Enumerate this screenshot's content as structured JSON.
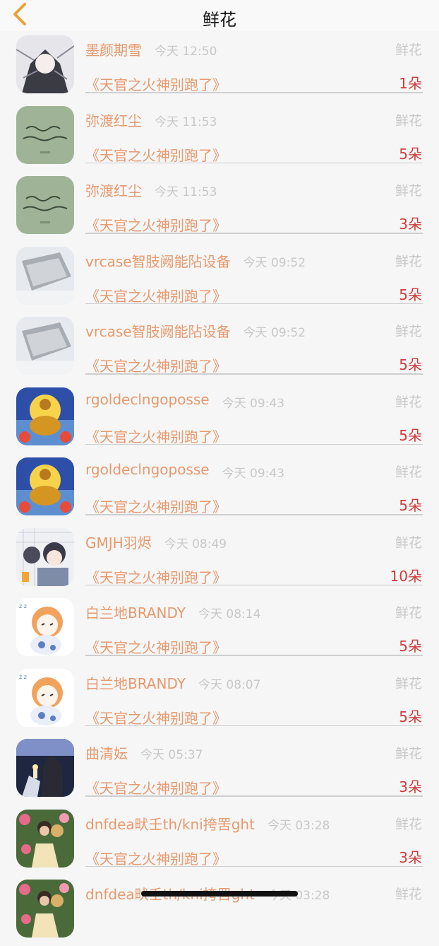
{
  "header": {
    "title": "鲜花"
  },
  "gift_label": "鲜花",
  "rows": [
    {
      "name": "墨颜期雪",
      "time": "今天 12:50",
      "book": "《天官之火神别跑了》",
      "count": "1朵",
      "avatar": "anime-girl-sketch"
    },
    {
      "name": "弥渡红尘",
      "time": "今天 11:53",
      "book": "《天官之火神别跑了》",
      "count": "5朵",
      "avatar": "green-calligraphy"
    },
    {
      "name": "弥渡红尘",
      "time": "今天 11:53",
      "book": "《天官之火神别跑了》",
      "count": "3朵",
      "avatar": "green-calligraphy"
    },
    {
      "name": "vrcase智肢阙能阽设备",
      "time": "今天 09:52",
      "book": "《天官之火神别跑了》",
      "count": "5朵",
      "avatar": "grey-box"
    },
    {
      "name": "vrcase智肢阙能阽设备",
      "time": "今天 09:52",
      "book": "《天官之火神别跑了》",
      "count": "5朵",
      "avatar": "grey-box"
    },
    {
      "name": "rgoldeclngoposse",
      "time": "今天 09:43",
      "book": "《天官之火神别跑了》",
      "count": "5朵",
      "avatar": "golden-buddha"
    },
    {
      "name": "rgoldeclngoposse",
      "time": "今天 09:43",
      "book": "《天官之火神别跑了》",
      "count": "5朵",
      "avatar": "golden-buddha"
    },
    {
      "name": "GMJH羽烬",
      "time": "今天 08:49",
      "book": "《天官之火神别跑了》",
      "count": "10朵",
      "avatar": "anime-boys"
    },
    {
      "name": "白兰地BRANDY",
      "time": "今天 08:14",
      "book": "《天官之火神别跑了》",
      "count": "5朵",
      "avatar": "chibi-girl"
    },
    {
      "name": "白兰地BRANDY",
      "time": "今天 08:07",
      "book": "《天官之火神别跑了》",
      "count": "5朵",
      "avatar": "chibi-girl"
    },
    {
      "name": "曲清妘",
      "time": "今天 05:37",
      "book": "《天官之火神别跑了》",
      "count": "3朵",
      "avatar": "candle-couple"
    },
    {
      "name": "dnfdea畎壬th/kni挎罟ght",
      "time": "今天 03:28",
      "book": "《天官之火神别跑了》",
      "count": "3朵",
      "avatar": "flower-couple"
    },
    {
      "name": "dnfdea畎壬th/kni挎罟ght",
      "time": "今天 03:28",
      "book": "",
      "count": "",
      "avatar": "flower-couple"
    }
  ]
}
